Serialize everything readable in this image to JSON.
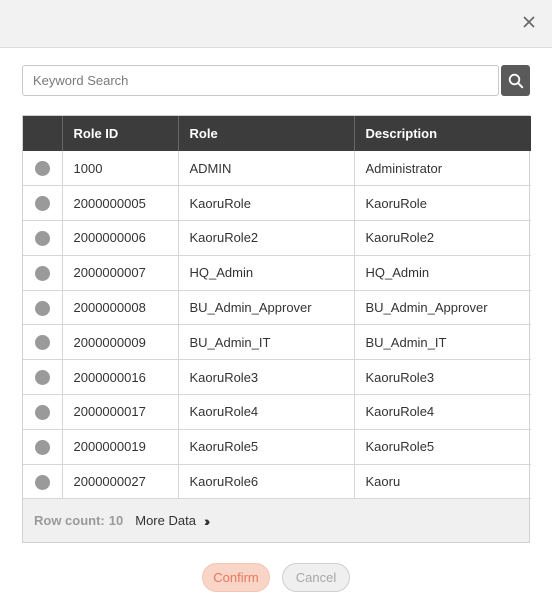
{
  "dialog": {
    "close_icon": "close-icon"
  },
  "search": {
    "placeholder": "Keyword Search",
    "value": "",
    "icon": "search-icon"
  },
  "table": {
    "columns": [
      "",
      "Role ID",
      "Role",
      "Description"
    ],
    "rows": [
      {
        "role_id": "1000",
        "role": "ADMIN",
        "description": "Administrator"
      },
      {
        "role_id": "2000000005",
        "role": "KaoruRole",
        "description": "KaoruRole"
      },
      {
        "role_id": "2000000006",
        "role": "KaoruRole2",
        "description": "KaoruRole2"
      },
      {
        "role_id": "2000000007",
        "role": "HQ_Admin",
        "description": "HQ_Admin"
      },
      {
        "role_id": "2000000008",
        "role": "BU_Admin_Approver",
        "description": "BU_Admin_Approver"
      },
      {
        "role_id": "2000000009",
        "role": "BU_Admin_IT",
        "description": "BU_Admin_IT"
      },
      {
        "role_id": "2000000016",
        "role": "KaoruRole3",
        "description": "KaoruRole3"
      },
      {
        "role_id": "2000000017",
        "role": "KaoruRole4",
        "description": "KaoruRole4"
      },
      {
        "role_id": "2000000019",
        "role": "KaoruRole5",
        "description": "KaoruRole5"
      },
      {
        "role_id": "2000000027",
        "role": "KaoruRole6",
        "description": "Kaoru"
      }
    ]
  },
  "footer": {
    "row_count_label": "Row count:",
    "row_count_value": "10",
    "more_data_label": "More Data",
    "more_icon": "double-chevron-right-icon"
  },
  "actions": {
    "confirm_label": "Confirm",
    "cancel_label": "Cancel"
  },
  "colors": {
    "header_bg": "#3c3c3c",
    "confirm_bg": "#f9d5c7",
    "confirm_text": "#e8785a",
    "radio": "#9a9a9a"
  }
}
